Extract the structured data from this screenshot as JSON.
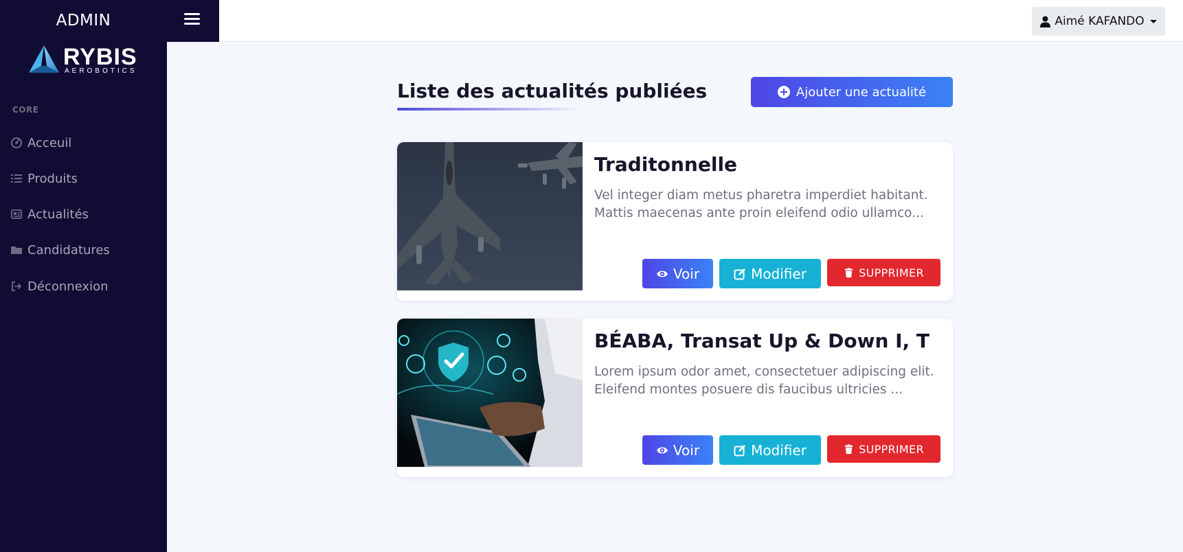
{
  "app": {
    "brand_title": "ADMIN",
    "logo_name": "RYBIS",
    "logo_subtitle": "AEROBOTICS"
  },
  "header": {
    "user_name": "Aimé KAFANDO"
  },
  "sidebar": {
    "section_label": "CORE",
    "items": [
      {
        "label": "Acceuil",
        "icon": "dashboard-gauge-icon"
      },
      {
        "label": "Produits",
        "icon": "list-icon"
      },
      {
        "label": "Actualités",
        "icon": "newspaper-icon"
      },
      {
        "label": "Candidatures",
        "icon": "folder-icon"
      },
      {
        "label": "Déconnexion",
        "icon": "sign-out-icon"
      }
    ]
  },
  "main": {
    "heading": "Liste des actualités publiées",
    "add_button_label": "Ajouter une actualité",
    "articles": [
      {
        "title": "Traditonnelle",
        "excerpt": "Vel integer diam metus pharetra imperdiet habitant. Mattis maecenas ante proin eleifend odio ullamco...",
        "image": "fighter-jets-photo",
        "actions": {
          "view": "Voir",
          "edit": "Modifier",
          "delete": "SUPPRIMER"
        }
      },
      {
        "title": "BÉABA, Transat Up & Down I, T",
        "excerpt": "Lorem ipsum odor amet, consectetuer adipiscing elit. Eleifend montes posuere dis faucibus ultricies ...",
        "image": "cybersecurity-tablet-photo",
        "actions": {
          "view": "Voir",
          "edit": "Modifier",
          "delete": "SUPPRIMER"
        }
      }
    ]
  },
  "colors": {
    "sidebar_bg": "#110c34",
    "primary_gradient_start": "#4f46e5",
    "primary_gradient_end": "#3b82f6",
    "info": "#17b1d6",
    "danger": "#e3272e",
    "page_bg": "#f4f7fc"
  }
}
